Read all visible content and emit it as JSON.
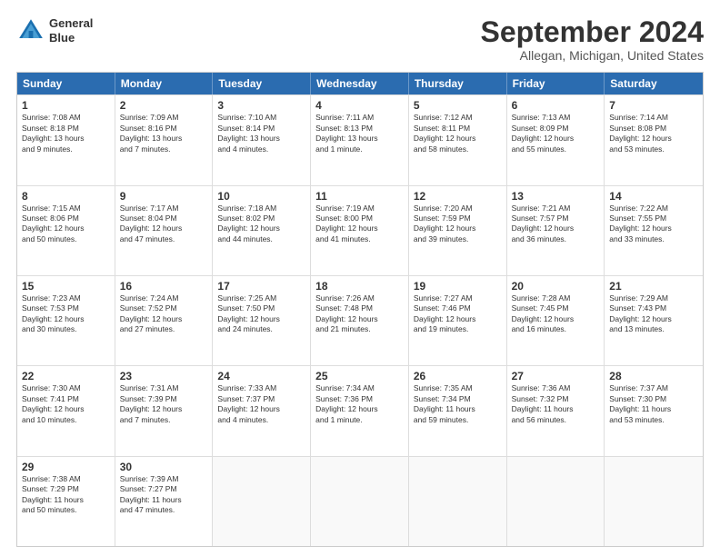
{
  "header": {
    "logo_line1": "General",
    "logo_line2": "Blue",
    "month_title": "September 2024",
    "location": "Allegan, Michigan, United States"
  },
  "days_of_week": [
    "Sunday",
    "Monday",
    "Tuesday",
    "Wednesday",
    "Thursday",
    "Friday",
    "Saturday"
  ],
  "weeks": [
    [
      {
        "day": "1",
        "info": "Sunrise: 7:08 AM\nSunset: 8:18 PM\nDaylight: 13 hours\nand 9 minutes."
      },
      {
        "day": "2",
        "info": "Sunrise: 7:09 AM\nSunset: 8:16 PM\nDaylight: 13 hours\nand 7 minutes."
      },
      {
        "day": "3",
        "info": "Sunrise: 7:10 AM\nSunset: 8:14 PM\nDaylight: 13 hours\nand 4 minutes."
      },
      {
        "day": "4",
        "info": "Sunrise: 7:11 AM\nSunset: 8:13 PM\nDaylight: 13 hours\nand 1 minute."
      },
      {
        "day": "5",
        "info": "Sunrise: 7:12 AM\nSunset: 8:11 PM\nDaylight: 12 hours\nand 58 minutes."
      },
      {
        "day": "6",
        "info": "Sunrise: 7:13 AM\nSunset: 8:09 PM\nDaylight: 12 hours\nand 55 minutes."
      },
      {
        "day": "7",
        "info": "Sunrise: 7:14 AM\nSunset: 8:08 PM\nDaylight: 12 hours\nand 53 minutes."
      }
    ],
    [
      {
        "day": "8",
        "info": "Sunrise: 7:15 AM\nSunset: 8:06 PM\nDaylight: 12 hours\nand 50 minutes."
      },
      {
        "day": "9",
        "info": "Sunrise: 7:17 AM\nSunset: 8:04 PM\nDaylight: 12 hours\nand 47 minutes."
      },
      {
        "day": "10",
        "info": "Sunrise: 7:18 AM\nSunset: 8:02 PM\nDaylight: 12 hours\nand 44 minutes."
      },
      {
        "day": "11",
        "info": "Sunrise: 7:19 AM\nSunset: 8:00 PM\nDaylight: 12 hours\nand 41 minutes."
      },
      {
        "day": "12",
        "info": "Sunrise: 7:20 AM\nSunset: 7:59 PM\nDaylight: 12 hours\nand 39 minutes."
      },
      {
        "day": "13",
        "info": "Sunrise: 7:21 AM\nSunset: 7:57 PM\nDaylight: 12 hours\nand 36 minutes."
      },
      {
        "day": "14",
        "info": "Sunrise: 7:22 AM\nSunset: 7:55 PM\nDaylight: 12 hours\nand 33 minutes."
      }
    ],
    [
      {
        "day": "15",
        "info": "Sunrise: 7:23 AM\nSunset: 7:53 PM\nDaylight: 12 hours\nand 30 minutes."
      },
      {
        "day": "16",
        "info": "Sunrise: 7:24 AM\nSunset: 7:52 PM\nDaylight: 12 hours\nand 27 minutes."
      },
      {
        "day": "17",
        "info": "Sunrise: 7:25 AM\nSunset: 7:50 PM\nDaylight: 12 hours\nand 24 minutes."
      },
      {
        "day": "18",
        "info": "Sunrise: 7:26 AM\nSunset: 7:48 PM\nDaylight: 12 hours\nand 21 minutes."
      },
      {
        "day": "19",
        "info": "Sunrise: 7:27 AM\nSunset: 7:46 PM\nDaylight: 12 hours\nand 19 minutes."
      },
      {
        "day": "20",
        "info": "Sunrise: 7:28 AM\nSunset: 7:45 PM\nDaylight: 12 hours\nand 16 minutes."
      },
      {
        "day": "21",
        "info": "Sunrise: 7:29 AM\nSunset: 7:43 PM\nDaylight: 12 hours\nand 13 minutes."
      }
    ],
    [
      {
        "day": "22",
        "info": "Sunrise: 7:30 AM\nSunset: 7:41 PM\nDaylight: 12 hours\nand 10 minutes."
      },
      {
        "day": "23",
        "info": "Sunrise: 7:31 AM\nSunset: 7:39 PM\nDaylight: 12 hours\nand 7 minutes."
      },
      {
        "day": "24",
        "info": "Sunrise: 7:33 AM\nSunset: 7:37 PM\nDaylight: 12 hours\nand 4 minutes."
      },
      {
        "day": "25",
        "info": "Sunrise: 7:34 AM\nSunset: 7:36 PM\nDaylight: 12 hours\nand 1 minute."
      },
      {
        "day": "26",
        "info": "Sunrise: 7:35 AM\nSunset: 7:34 PM\nDaylight: 11 hours\nand 59 minutes."
      },
      {
        "day": "27",
        "info": "Sunrise: 7:36 AM\nSunset: 7:32 PM\nDaylight: 11 hours\nand 56 minutes."
      },
      {
        "day": "28",
        "info": "Sunrise: 7:37 AM\nSunset: 7:30 PM\nDaylight: 11 hours\nand 53 minutes."
      }
    ],
    [
      {
        "day": "29",
        "info": "Sunrise: 7:38 AM\nSunset: 7:29 PM\nDaylight: 11 hours\nand 50 minutes."
      },
      {
        "day": "30",
        "info": "Sunrise: 7:39 AM\nSunset: 7:27 PM\nDaylight: 11 hours\nand 47 minutes."
      },
      {
        "day": "",
        "info": ""
      },
      {
        "day": "",
        "info": ""
      },
      {
        "day": "",
        "info": ""
      },
      {
        "day": "",
        "info": ""
      },
      {
        "day": "",
        "info": ""
      }
    ]
  ]
}
